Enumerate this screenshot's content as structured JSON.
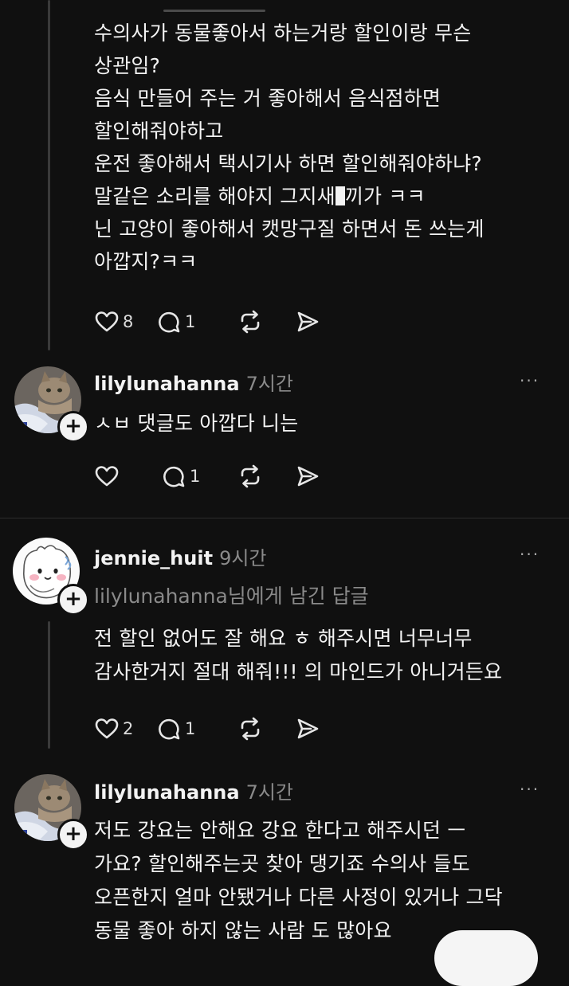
{
  "comment1": {
    "lines": [
      "수의사가 동물좋아서 하는거랑 할인이랑 무슨",
      "상관임?",
      "음식 만들어 주는 거 좋아해서 음식점하면",
      "할인해줘야하고",
      "운전 좋아해서 택시기사 하면 할인해줘야하냐?",
      "말같은 소리를 해야지 그지새",
      "끼가 ㅋㅋ",
      "닌 고양이 좋아해서 캣망구질 하면서 돈 쓰는게",
      "아깝지?ㅋㅋ"
    ],
    "likes": "8",
    "replies": "1"
  },
  "comment2": {
    "username": "lilylunahanna",
    "time": "7시간",
    "text": "ㅅㅂ 댓글도 아깝다 니는",
    "replies": "1"
  },
  "comment3": {
    "username": "jennie_huit",
    "time": "9시간",
    "reply_to_user": "lilylunahanna",
    "reply_to_suffix": "님에게 남긴 답글",
    "lines": [
      "전 할인 없어도 잘 해요 ㅎ 해주시면 너무너무",
      "감사한거지 절대 해줘!!! 의 마인드가 아니거든요"
    ],
    "likes": "2",
    "replies": "1"
  },
  "comment4": {
    "username": "lilylunahanna",
    "time": "7시간",
    "lines": [
      "저도 강요는 안해요 강요 한다고 해주시던 ㅡ",
      "가요? 할인해주는곳 찾아 댕기죠 수의사 들도",
      "오픈한지 얼마 안됐거나 다른 사정이 있거나 그닥",
      "동물 좋아 하지 않는 사람 도 많아요"
    ]
  },
  "icons": {
    "like": "heart-icon",
    "comment": "comment-icon",
    "repost": "repost-icon",
    "share": "send-icon",
    "more": "more-icon",
    "follow": "plus-icon"
  },
  "more_label": "···",
  "plus_label": "+"
}
